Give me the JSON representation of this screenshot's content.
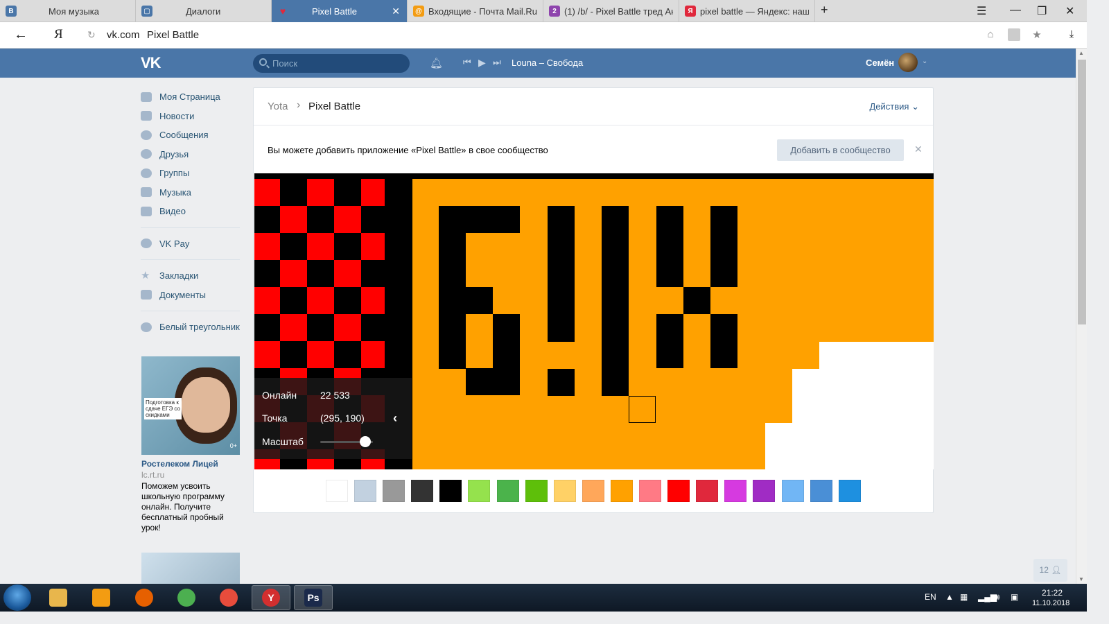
{
  "browser": {
    "tabs": [
      {
        "title": "Моя музыка",
        "favicon_color": "#4a76a8"
      },
      {
        "title": "Диалоги",
        "favicon_color": "#4a76a8"
      },
      {
        "title": "Pixel Battle",
        "favicon_color": "#e0283c"
      },
      {
        "title": "Входящие - Почта Mail.Ru",
        "favicon_color": "#f39c12"
      },
      {
        "title": "(1) /b/ - Pixel Battle тред Ан",
        "favicon_color": "#8e44ad"
      },
      {
        "title": "pixel battle — Яндекс: наше",
        "favicon_color": "#e0283c"
      }
    ],
    "new_tab": "+",
    "address": {
      "domain": "vk.com",
      "page_title": "Pixel Battle"
    },
    "yandex_logo": "Я"
  },
  "vk_header": {
    "logo": "VK",
    "search_placeholder": "Поиск",
    "now_playing": "Louna – Свобода",
    "user_name": "Семён"
  },
  "sidebar": {
    "items": [
      {
        "label": "Моя Страница",
        "icon": "home-icon"
      },
      {
        "label": "Новости",
        "icon": "news-icon"
      },
      {
        "label": "Сообщения",
        "icon": "messages-icon"
      },
      {
        "label": "Друзья",
        "icon": "friends-icon"
      },
      {
        "label": "Группы",
        "icon": "groups-icon"
      },
      {
        "label": "Музыка",
        "icon": "music-icon"
      },
      {
        "label": "Видео",
        "icon": "video-icon"
      }
    ],
    "items2": [
      {
        "label": "VK Pay",
        "icon": "vkpay-icon"
      }
    ],
    "items3": [
      {
        "label": "Закладки",
        "icon": "star-icon"
      },
      {
        "label": "Документы",
        "icon": "documents-icon"
      }
    ],
    "items4": [
      {
        "label": "Белый треугольник",
        "icon": "community-icon"
      }
    ]
  },
  "ad": {
    "image_text": "Подготовка к сдаче ЕГЭ со скидками",
    "age": "0+",
    "title": "Ростелеком Лицей",
    "url": "lc.rt.ru",
    "text": "Поможем усвоить школьную программу онлайн. Получите бесплатный пробный урок!"
  },
  "app": {
    "breadcrumb_parent": "Yota",
    "breadcrumb_current": "Pixel Battle",
    "actions_label": "Действия",
    "notice": "Вы можете добавить приложение «Pixel Battle» в свое сообщество",
    "add_button": "Добавить в сообщество",
    "info": {
      "online_label": "Онлайн",
      "online_value": "22 533",
      "point_label": "Точка",
      "point_value": "(295, 190)",
      "scale_label": "Масштаб",
      "scale_level": 0.85
    },
    "palette": [
      "#ffffff",
      "#c2d1e0",
      "#999999",
      "#333333",
      "#000000",
      "#95e24d",
      "#4bb34b",
      "#5ebf0a",
      "#ffd166",
      "#ffa75a",
      "#ffa100",
      "#ff7a85",
      "#ff0000",
      "#e0283c",
      "#d63ae0",
      "#a02cc4",
      "#71b6f5",
      "#4a8fd6",
      "#1e90e0"
    ],
    "online_users_count": "12"
  },
  "taskbar": {
    "apps": [
      {
        "name": "explorer",
        "color": "#e8b64c"
      },
      {
        "name": "media-player",
        "color": "#f39c12"
      },
      {
        "name": "firefox",
        "color": "#e66000"
      },
      {
        "name": "utorrent",
        "color": "#4caf50"
      },
      {
        "name": "media-player-classic",
        "color": "#e74c3c"
      },
      {
        "name": "yandex-browser",
        "color": "#d32f2f",
        "active": true,
        "glyph": "Y"
      },
      {
        "name": "photoshop",
        "color": "#1b2a4b",
        "active": true,
        "glyph": "Ps"
      }
    ],
    "lang": "EN",
    "time": "21:22",
    "date": "11.10.2018"
  }
}
